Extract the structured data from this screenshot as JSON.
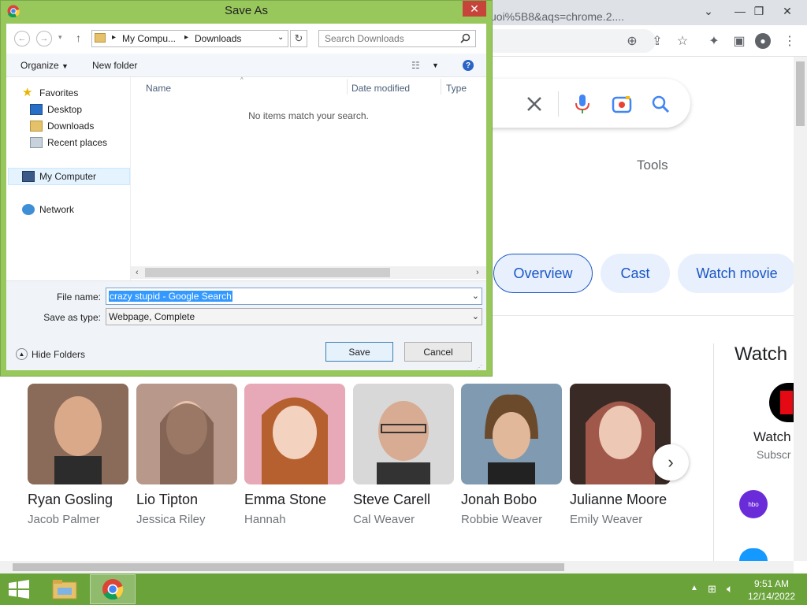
{
  "chrome": {
    "url_fragment": "uoi%5B8&aqs=chrome.2....",
    "tools_label": "Tools",
    "chips": [
      "Overview",
      "Cast",
      "Watch movie"
    ],
    "watch_heading": "Watch r",
    "watch_label": "Watch",
    "watch_sub": "Subscr"
  },
  "cast": [
    {
      "name": "Ryan Gosling",
      "role": "Jacob Palmer",
      "bg": "#8a6a58"
    },
    {
      "name": "Lio Tipton",
      "role": "Jessica Riley",
      "bg": "#b7988a"
    },
    {
      "name": "Emma Stone",
      "role": "Hannah",
      "bg": "#e7a9b7"
    },
    {
      "name": "Steve Carell",
      "role": "Cal Weaver",
      "bg": "#c9c9c9"
    },
    {
      "name": "Jonah Bobo",
      "role": "Robbie Weaver",
      "bg": "#7f9ab1"
    },
    {
      "name": "Julianne Moore",
      "role": "Emily Weaver",
      "bg": "#a0584a"
    }
  ],
  "dialog": {
    "title": "Save As",
    "breadcrumb": [
      "My Compu...",
      "Downloads"
    ],
    "search_placeholder": "Search Downloads",
    "organize": "Organize",
    "new_folder": "New folder",
    "nav_pane": {
      "favorites": "Favorites",
      "desktop": "Desktop",
      "downloads": "Downloads",
      "recent": "Recent places",
      "computer": "My Computer",
      "network": "Network"
    },
    "columns": {
      "name": "Name",
      "date": "Date modified",
      "type": "Type"
    },
    "empty_message": "No items match your search.",
    "file_name_label": "File name:",
    "file_name_value": "crazy stupid - Google Search",
    "save_type_label": "Save as type:",
    "save_type_value": "Webpage, Complete",
    "hide_folders": "Hide Folders",
    "save_btn": "Save",
    "cancel_btn": "Cancel"
  },
  "taskbar": {
    "time": "9:51 AM",
    "date": "12/14/2022"
  },
  "colors": {
    "dialog_frame": "#98c85c",
    "taskbar": "#6ba33b",
    "chip_text": "#1a56c4",
    "close_red": "#c7443a"
  }
}
